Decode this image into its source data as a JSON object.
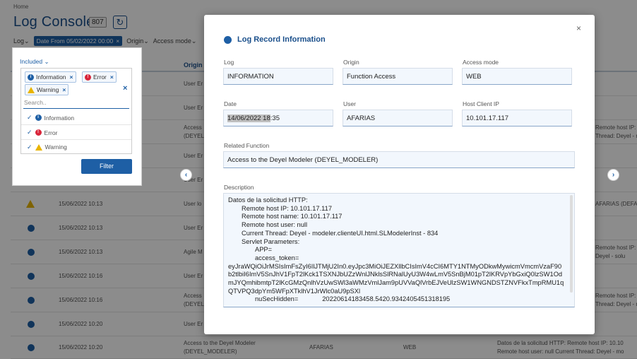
{
  "breadcrumb": "Home",
  "page": {
    "title": "Log Console",
    "count": "807"
  },
  "filter_bar": {
    "log": "Log",
    "date_chip": "Date From 05/02/2022 00:00",
    "chip_close": "×",
    "origin": "Origin",
    "access_mode": "Access mode"
  },
  "table": {
    "origin_header": "Origin",
    "rows": [
      {
        "icon": "info",
        "date": "",
        "origin": "User Er"
      },
      {
        "icon": "info",
        "date": "",
        "origin": "User Er"
      },
      {
        "icon": "info",
        "date": "",
        "origin": "Access",
        "origin2": "(DEYEL",
        "details": "Remote host IP: 10.10",
        "details2": "Thread: Deyel - mo"
      },
      {
        "icon": "info",
        "date": "",
        "origin": "User Er"
      },
      {
        "icon": "info",
        "date": "",
        "origin": "User Er"
      },
      {
        "icon": "warning",
        "date": "15/06/2022 10:13",
        "origin": "User lo",
        "details": "AFARIAS (DEFAU"
      },
      {
        "icon": "info",
        "date": "15/06/2022 10:13",
        "origin": "User Er"
      },
      {
        "icon": "info",
        "date": "15/06/2022 10:13",
        "origin": "Agile M",
        "details": "Remote host IP: 10.10",
        "details2": "Deyel - solu"
      },
      {
        "icon": "info",
        "date": "15/06/2022 10:16",
        "origin": "User Er"
      },
      {
        "icon": "info",
        "date": "15/06/2022 10:16",
        "origin": "Access",
        "origin2": "(DEYEL",
        "details": "Remote host IP: 10.10",
        "details2": "Thread: Deyel - mo"
      },
      {
        "icon": "info",
        "date": "15/06/2022 10:20",
        "origin": "User Er"
      },
      {
        "icon": "info",
        "date": "15/06/2022 10:20",
        "origin": "Access to the Deyel Modeler",
        "origin2": "(DEYEL_MODELER)",
        "user": "AFARIAS",
        "mode": "WEB",
        "details": "Datos de la solicitud HTTP: Remote host IP: 10.10",
        "details2": "Remote host user: null Current Thread: Deyel - mo"
      }
    ]
  },
  "filter_dropdown": {
    "included_label": "Included",
    "tags": [
      {
        "label": "Information",
        "icon": "info-icon"
      },
      {
        "label": "Error",
        "icon": "error-icon"
      },
      {
        "label": "Warning",
        "icon": "warning-icon"
      }
    ],
    "tag_remove": "×",
    "clear_all": "×",
    "search_placeholder": "Search..",
    "options": [
      {
        "label": "Information",
        "checked": true
      },
      {
        "label": "Error",
        "checked": true
      },
      {
        "label": "Warning",
        "checked": true
      }
    ],
    "filter_button": "Filter"
  },
  "modal": {
    "title": "Log Record Information",
    "close": "×",
    "fields": {
      "log": {
        "label": "Log",
        "value": "INFORMATION"
      },
      "origin": {
        "label": "Origin",
        "value": "Function Access"
      },
      "access_mode": {
        "label": "Access mode",
        "value": "WEB"
      },
      "date": {
        "label": "Date",
        "value_selected": "14/06/2022 18",
        "value_rest": ":35"
      },
      "user": {
        "label": "User",
        "value": "AFARIAS"
      },
      "host_ip": {
        "label": "Host Client IP",
        "value": "10.101.17.117"
      },
      "related_function": {
        "label": "Related Function",
        "value": "Access to the Deyel Modeler (DEYEL_MODELER)"
      }
    },
    "description": {
      "label": "Description",
      "lines": [
        "Datos de la solicitud HTTP:",
        "Remote host IP: 10.101.17.117",
        "Remote host name: 10.101.17.117",
        "Remote host user: null",
        "Current Thread: Deyel - modeler.clienteUI.html.SLModelerInst - 834",
        "Servlet Parameters:",
        "APP=",
        "access_token=",
        "eyJraWQiOiJrMSIsImFsZyI6IlJTMjU2In0.eyJpc3MiOiJEZXllbCIsImV4cCI6MTY1NTMyODkwMywicmVmcmVzaF90b2tlbiI6ImV5SnJhV1FpT2lKck1TSXNJbUZzWnlJNklsSlRNalUyU3W4wLmV5SnBjM01pT2lKRVpYbGxiQ0lzSW1OdmJYQmhibmtpT2lKcGMzQnlhVzUwSWl3aWMzVmlJam9pUVVaQlVrbEJVeUlzSW1WNGNDSTZNVFkxTmpRMU1qQTVPQ3dpYm5WFpXTklhV1JrWlc0aU9pSXl",
        "nuSecHidden=",
        "20220614183458.5420.9342405451318195"
      ]
    }
  }
}
